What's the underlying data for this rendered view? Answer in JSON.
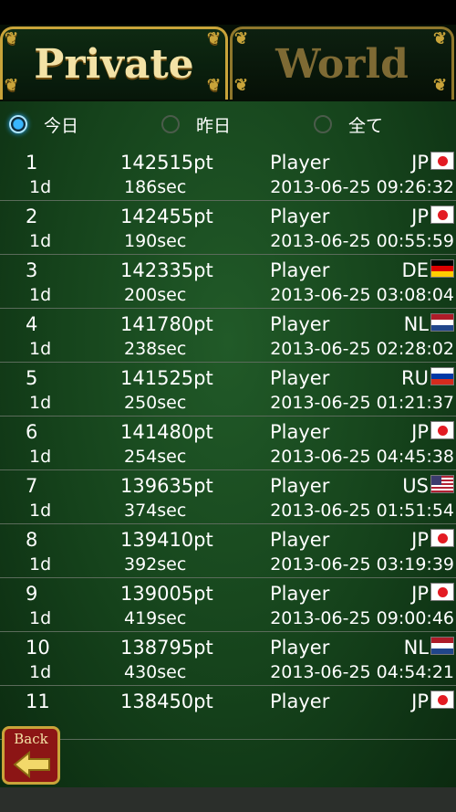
{
  "tabs": {
    "private": "Private",
    "world": "World"
  },
  "filters": [
    {
      "label": "今日",
      "selected": true
    },
    {
      "label": "昨日",
      "selected": false
    },
    {
      "label": "全て",
      "selected": false
    }
  ],
  "rows": [
    {
      "rank": "1",
      "points": "142515pt",
      "name": "Player",
      "country": "JP",
      "period": "1d",
      "time": "186sec",
      "date": "2013-06-25 09:26:32"
    },
    {
      "rank": "2",
      "points": "142455pt",
      "name": "Player",
      "country": "JP",
      "period": "1d",
      "time": "190sec",
      "date": "2013-06-25 00:55:59"
    },
    {
      "rank": "3",
      "points": "142335pt",
      "name": "Player",
      "country": "DE",
      "period": "1d",
      "time": "200sec",
      "date": "2013-06-25 03:08:04"
    },
    {
      "rank": "4",
      "points": "141780pt",
      "name": "Player",
      "country": "NL",
      "period": "1d",
      "time": "238sec",
      "date": "2013-06-25 02:28:02"
    },
    {
      "rank": "5",
      "points": "141525pt",
      "name": "Player",
      "country": "RU",
      "period": "1d",
      "time": "250sec",
      "date": "2013-06-25 01:21:37"
    },
    {
      "rank": "6",
      "points": "141480pt",
      "name": "Player",
      "country": "JP",
      "period": "1d",
      "time": "254sec",
      "date": "2013-06-25 04:45:38"
    },
    {
      "rank": "7",
      "points": "139635pt",
      "name": "Player",
      "country": "US",
      "period": "1d",
      "time": "374sec",
      "date": "2013-06-25 01:51:54"
    },
    {
      "rank": "8",
      "points": "139410pt",
      "name": "Player",
      "country": "JP",
      "period": "1d",
      "time": "392sec",
      "date": "2013-06-25 03:19:39"
    },
    {
      "rank": "9",
      "points": "139005pt",
      "name": "Player",
      "country": "JP",
      "period": "1d",
      "time": "419sec",
      "date": "2013-06-25 09:00:46"
    },
    {
      "rank": "10",
      "points": "138795pt",
      "name": "Player",
      "country": "NL",
      "period": "1d",
      "time": "430sec",
      "date": "2013-06-25 04:54:21"
    },
    {
      "rank": "11",
      "points": "138450pt",
      "name": "Player",
      "country": "JP"
    }
  ],
  "back_label": "Back"
}
